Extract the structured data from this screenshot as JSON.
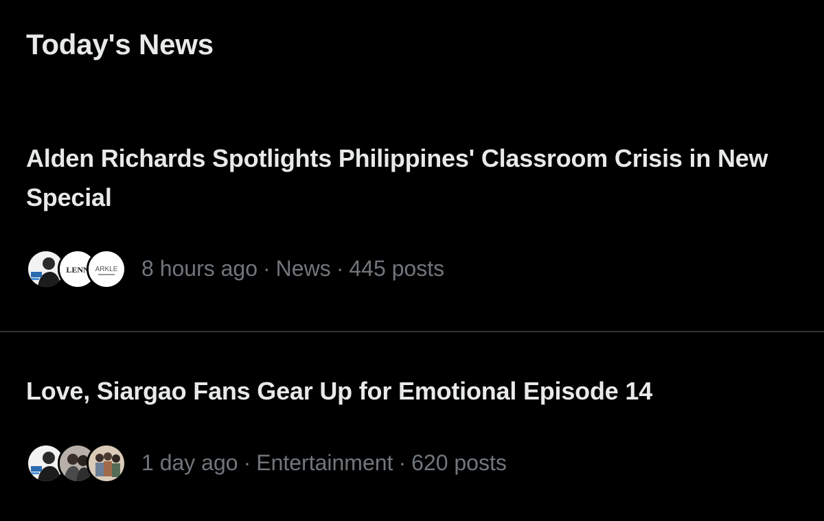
{
  "section": {
    "title": "Today's News"
  },
  "news": [
    {
      "headline": "Alden Richards Spotlights Philippines' Classroom Crisis in New Special",
      "time": "8 hours ago",
      "category": "News",
      "posts": "445 posts",
      "separator": "·",
      "avatars": [
        {
          "icon": "person-portrait-avatar-icon"
        },
        {
          "icon": "lenn-logo-avatar-icon",
          "text": "LENN"
        },
        {
          "icon": "arkle-logo-avatar-icon",
          "text": "ARKLE"
        }
      ]
    },
    {
      "headline": "Love, Siargao Fans Gear Up for Emotional Episode 14",
      "time": "1 day ago",
      "category": "Entertainment",
      "posts": "620 posts",
      "separator": "·",
      "avatars": [
        {
          "icon": "person-portrait-avatar-icon"
        },
        {
          "icon": "couple-photo-avatar-icon"
        },
        {
          "icon": "group-photo-avatar-icon"
        }
      ]
    }
  ],
  "colors": {
    "background": "#000000",
    "primary_text": "#e7e9ea",
    "secondary_text": "#71767b",
    "divider": "#2f3336"
  }
}
